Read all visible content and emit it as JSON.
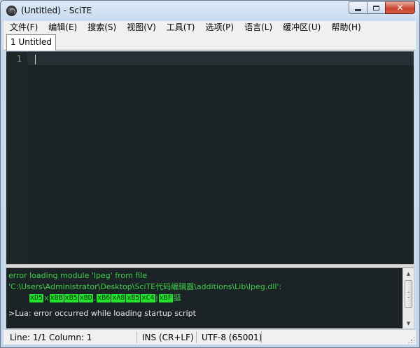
{
  "window": {
    "title": "(Untitled) - SciTE"
  },
  "menu": {
    "items": [
      {
        "label": "文件(F)"
      },
      {
        "label": "编辑(E)"
      },
      {
        "label": "搜索(S)"
      },
      {
        "label": "视图(V)"
      },
      {
        "label": "工具(T)"
      },
      {
        "label": "选项(P)"
      },
      {
        "label": "语言(L)"
      },
      {
        "label": "缓冲区(U)"
      },
      {
        "label": "帮助(H)"
      }
    ]
  },
  "tabs": [
    {
      "label": "1 Untitled"
    }
  ],
  "editor": {
    "line_numbers": [
      "1"
    ],
    "colors": {
      "background": "#1b2326",
      "gutter": "#1f2628",
      "current_line": "#243033"
    }
  },
  "output": {
    "line1": "error loading module 'lpeg' from file",
    "line2": "'C:\\Users\\Administrator\\Desktop\\SciTE代码编辑器\\additions\\Lib\\lpeg.dll':",
    "hex": [
      "xD5",
      "x",
      "xBB",
      "xB5",
      "xBD",
      ",",
      "xB6",
      "xA8",
      "xB5",
      "xC4",
      "j",
      "xBF",
      "謳"
    ],
    "line4": ">Lua: error occurred while loading startup script",
    "colors": {
      "error_text": "#3fd04a",
      "hex_badge": "#22e22b",
      "normal_text": "#e8e8e8"
    }
  },
  "status": {
    "position": "Line: 1/1  Column: 1",
    "mode": "INS (CR+LF)",
    "encoding": "UTF-8 (65001)"
  }
}
